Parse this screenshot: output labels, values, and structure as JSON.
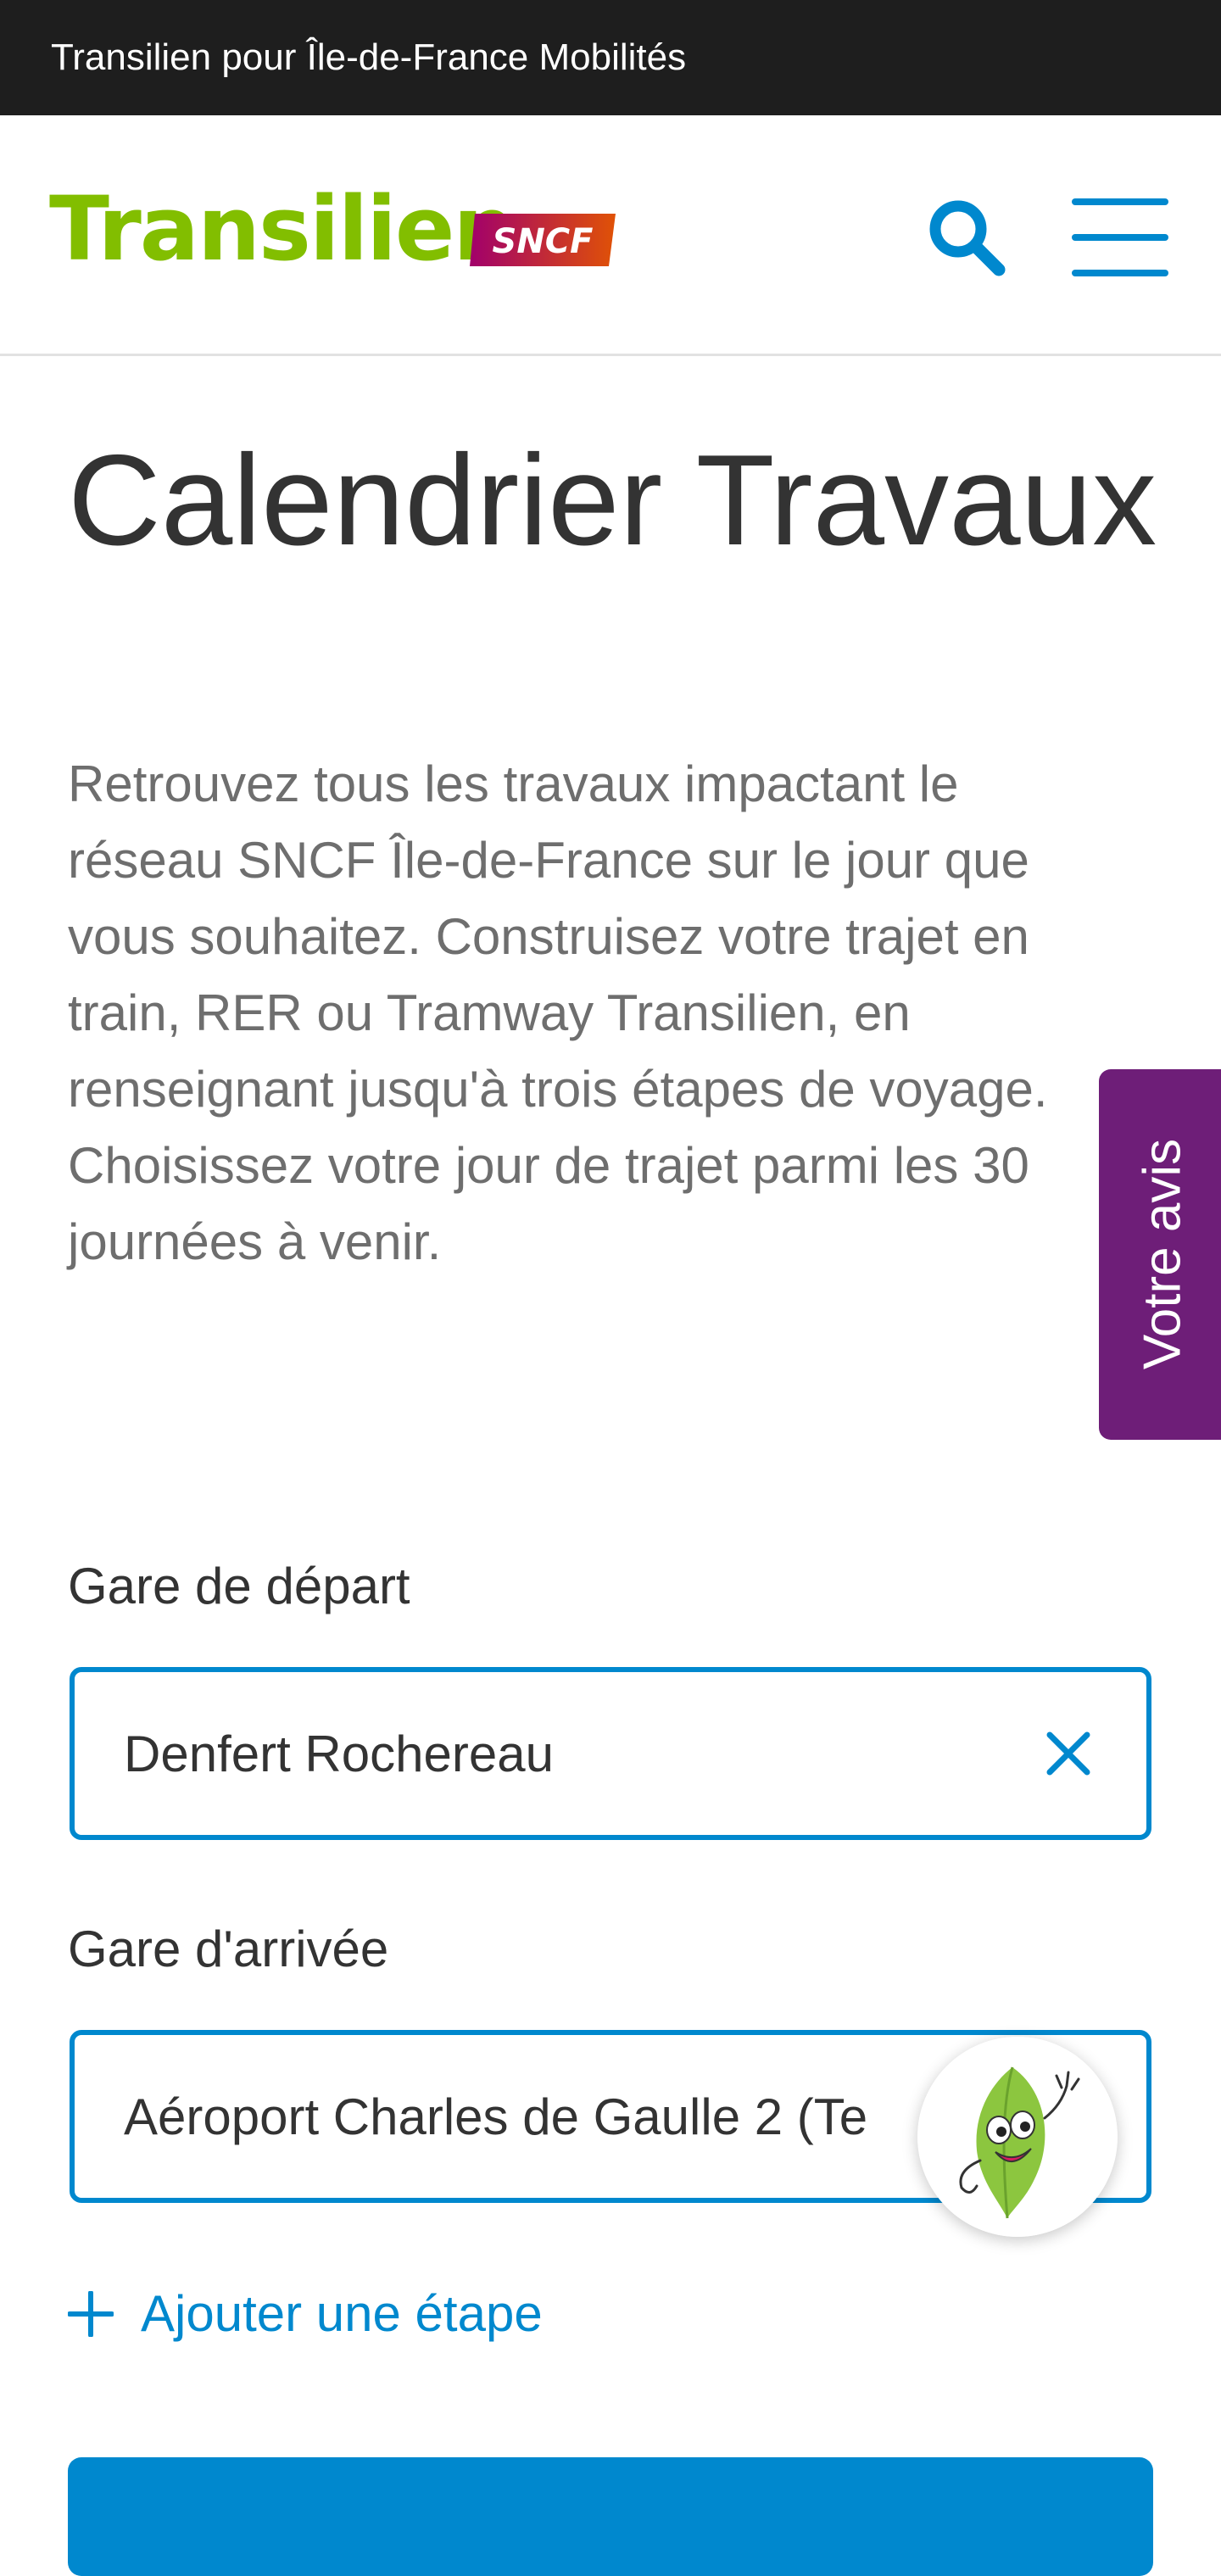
{
  "topbar": {
    "text": "Transilien pour Île-de-France Mobilités"
  },
  "header": {
    "logo_text": "Transilien",
    "logo_badge": "SNCF",
    "search_icon": "search-icon",
    "menu_icon": "hamburger-menu-icon"
  },
  "page": {
    "title": "Calendrier Travaux",
    "intro": "Retrouvez tous les travaux impactant le réseau SNCF Île-de-France sur le jour que vous souhaitez. Construisez votre trajet en train, RER ou Tramway Transilien, en renseignant jusqu'à trois étapes de voyage. Choisissez votre jour de trajet parmi les 30 journées à venir."
  },
  "feedback": {
    "label": "Votre avis"
  },
  "form": {
    "departure_label": "Gare de départ",
    "departure_value": "Denfert Rochereau",
    "clear_icon": "close-icon",
    "arrival_label": "Gare d'arrivée",
    "arrival_value": "Aéroport Charles de Gaulle 2 (Te",
    "add_step_label": "Ajouter une étape",
    "add_icon": "plus-icon"
  },
  "mascot": {
    "icon": "leaf-mascot-icon"
  },
  "colors": {
    "topbar_bg": "#1e1e1e",
    "brand_green": "#82be00",
    "sncf_magenta": "#c2185b",
    "accent_blue": "#0088ce",
    "feedback_purple": "#6e1e78",
    "title_text": "#333333",
    "body_text": "#6e6e6e"
  }
}
